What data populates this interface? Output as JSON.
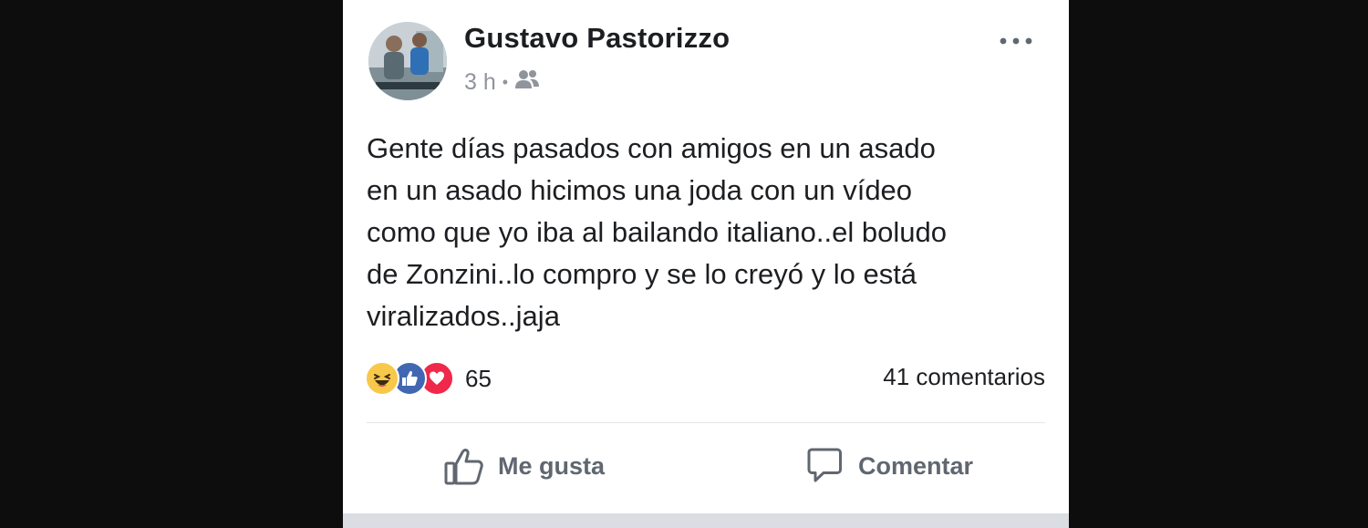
{
  "post": {
    "author": "Gustavo Pastorizzo",
    "time": "3 h",
    "separator": "•",
    "audience_icon": "friends-icon",
    "more_icon": "more-options-icon",
    "body_lines": [
      "Gente días pasados con amigos en un asado",
      "en un asado hicimos una joda con un vídeo",
      "como que yo iba al bailando italiano..el boludo",
      "de Zonzini..lo compro y se lo creyó y lo está",
      "viralizados..jaja"
    ]
  },
  "reactions": {
    "icons": [
      "haha-icon",
      "like-icon",
      "love-icon"
    ],
    "count": "65",
    "comments": "41 comentarios"
  },
  "actions": {
    "like_label": "Me gusta",
    "comment_label": "Comentar"
  },
  "colors": {
    "background": "#0d0d0d",
    "card": "#ffffff",
    "text": "#1c1e21",
    "muted": "#90949c",
    "like_blue": "#4267b2",
    "love_red": "#f0284a",
    "haha_yellow": "#f7c84a"
  }
}
